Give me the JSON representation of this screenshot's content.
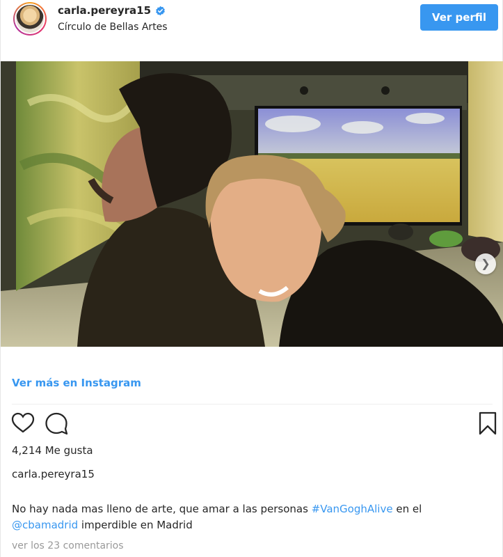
{
  "header": {
    "username": "carla.pereyra15",
    "location": "Círculo de Bellas Artes",
    "view_profile_label": "Ver perfil",
    "verified_icon": "verified-badge-icon"
  },
  "post": {
    "see_more_label": "Ver más en Instagram",
    "likes_text": "4,214 Me gusta",
    "author": "carla.pereyra15",
    "caption_text_1": "No hay nada mas lleno de arte, que amar a las personas ",
    "caption_hashtag": "#VanGoghAlive",
    "caption_text_2": " en el ",
    "caption_mention": "@cbamadrid",
    "caption_text_3": " imperdible en Madrid",
    "comments_link": "ver los 23 comentarios"
  },
  "colors": {
    "accent": "#3897f0",
    "text": "#262626",
    "muted": "#999999"
  },
  "icons": {
    "like": "heart-icon",
    "comment": "comment-icon",
    "save": "bookmark-icon",
    "carousel_next": "chevron-right-icon"
  }
}
